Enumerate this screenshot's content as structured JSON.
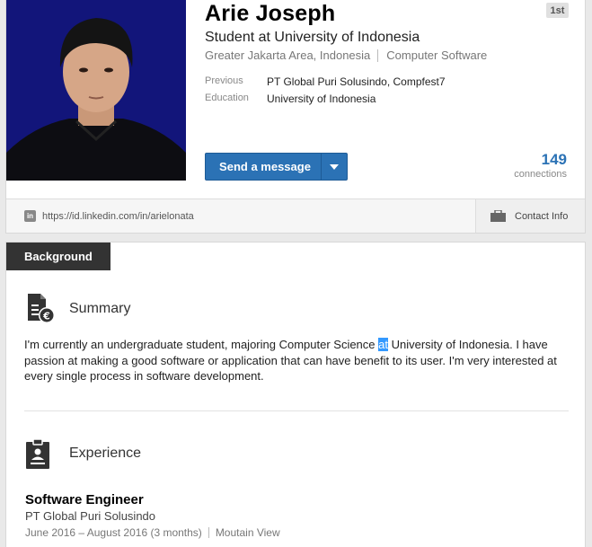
{
  "profile": {
    "name": "Arie Joseph",
    "degree": "1st",
    "headline": "Student at University of Indonesia",
    "location": "Greater Jakarta Area, Indonesia",
    "industry": "Computer Software",
    "previous_label": "Previous",
    "previous_value": "PT Global Puri Solusindo, Compfest7",
    "education_label": "Education",
    "education_value": "University of Indonesia",
    "message_button": "Send a message",
    "connections_count": "149",
    "connections_label": "connections",
    "public_url": "https://id.linkedin.com/in/arielonata",
    "contact_info": "Contact Info"
  },
  "background": {
    "tab_label": "Background",
    "summary": {
      "title": "Summary",
      "text_before": "I'm currently an undergraduate student, majoring Computer Science ",
      "text_highlight": "at",
      "text_after": " University of Indonesia. I have passion at making a good software or application that can have benefit to its user. I'm very interested at every single process in software development."
    },
    "experience": {
      "title": "Experience",
      "job_title": "Software Engineer",
      "company": "PT Global Puri Solusindo",
      "dates": "June 2016 – August 2016 (3 months)",
      "location": "Moutain View"
    }
  },
  "colors": {
    "accent": "#2b72b5",
    "tab_bg": "#333333",
    "photo_bg": "#12157a",
    "highlight": "#3399ff"
  },
  "icons": [
    "linkedin-icon",
    "briefcase-icon",
    "summary-document-icon",
    "experience-badge-icon",
    "chevron-down-icon"
  ]
}
